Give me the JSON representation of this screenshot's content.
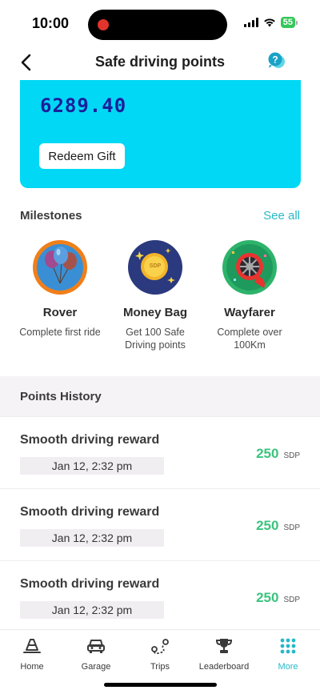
{
  "status_bar": {
    "time": "10:00",
    "battery": "55"
  },
  "header": {
    "title": "Safe driving points"
  },
  "points_card": {
    "value": "6289.40",
    "redeem_label": "Redeem Gift"
  },
  "milestones": {
    "heading": "Milestones",
    "see_all": "See all",
    "items": [
      {
        "name": "Rover",
        "description": "Complete first ride",
        "icon": "balloons-icon"
      },
      {
        "name": "Money Bag",
        "description": "Get 100 Safe Driving points",
        "icon": "coin-icon",
        "coin_text": "SDP"
      },
      {
        "name": "Wayfarer",
        "description": "Complete over 100Km",
        "icon": "wheel-icon"
      }
    ]
  },
  "history": {
    "heading": "Points History",
    "items": [
      {
        "title": "Smooth driving reward",
        "date": "Jan 12, 2:32 pm",
        "amount": "250",
        "unit": "SDP"
      },
      {
        "title": "Smooth driving reward",
        "date": "Jan 12, 2:32 pm",
        "amount": "250",
        "unit": "SDP"
      },
      {
        "title": "Smooth driving reward",
        "date": "Jan 12, 2:32 pm",
        "amount": "250",
        "unit": "SDP"
      }
    ]
  },
  "tabs": [
    {
      "label": "Home",
      "icon": "home-cone-icon"
    },
    {
      "label": "Garage",
      "icon": "car-icon"
    },
    {
      "label": "Trips",
      "icon": "route-icon"
    },
    {
      "label": "Leaderboard",
      "icon": "trophy-icon"
    },
    {
      "label": "More",
      "icon": "grid-dots-icon",
      "active": true
    }
  ],
  "colors": {
    "accent": "#27b9c8",
    "card": "#00d8f5",
    "points_text": "#1b1f9c",
    "reward_green": "#3ac47d"
  }
}
